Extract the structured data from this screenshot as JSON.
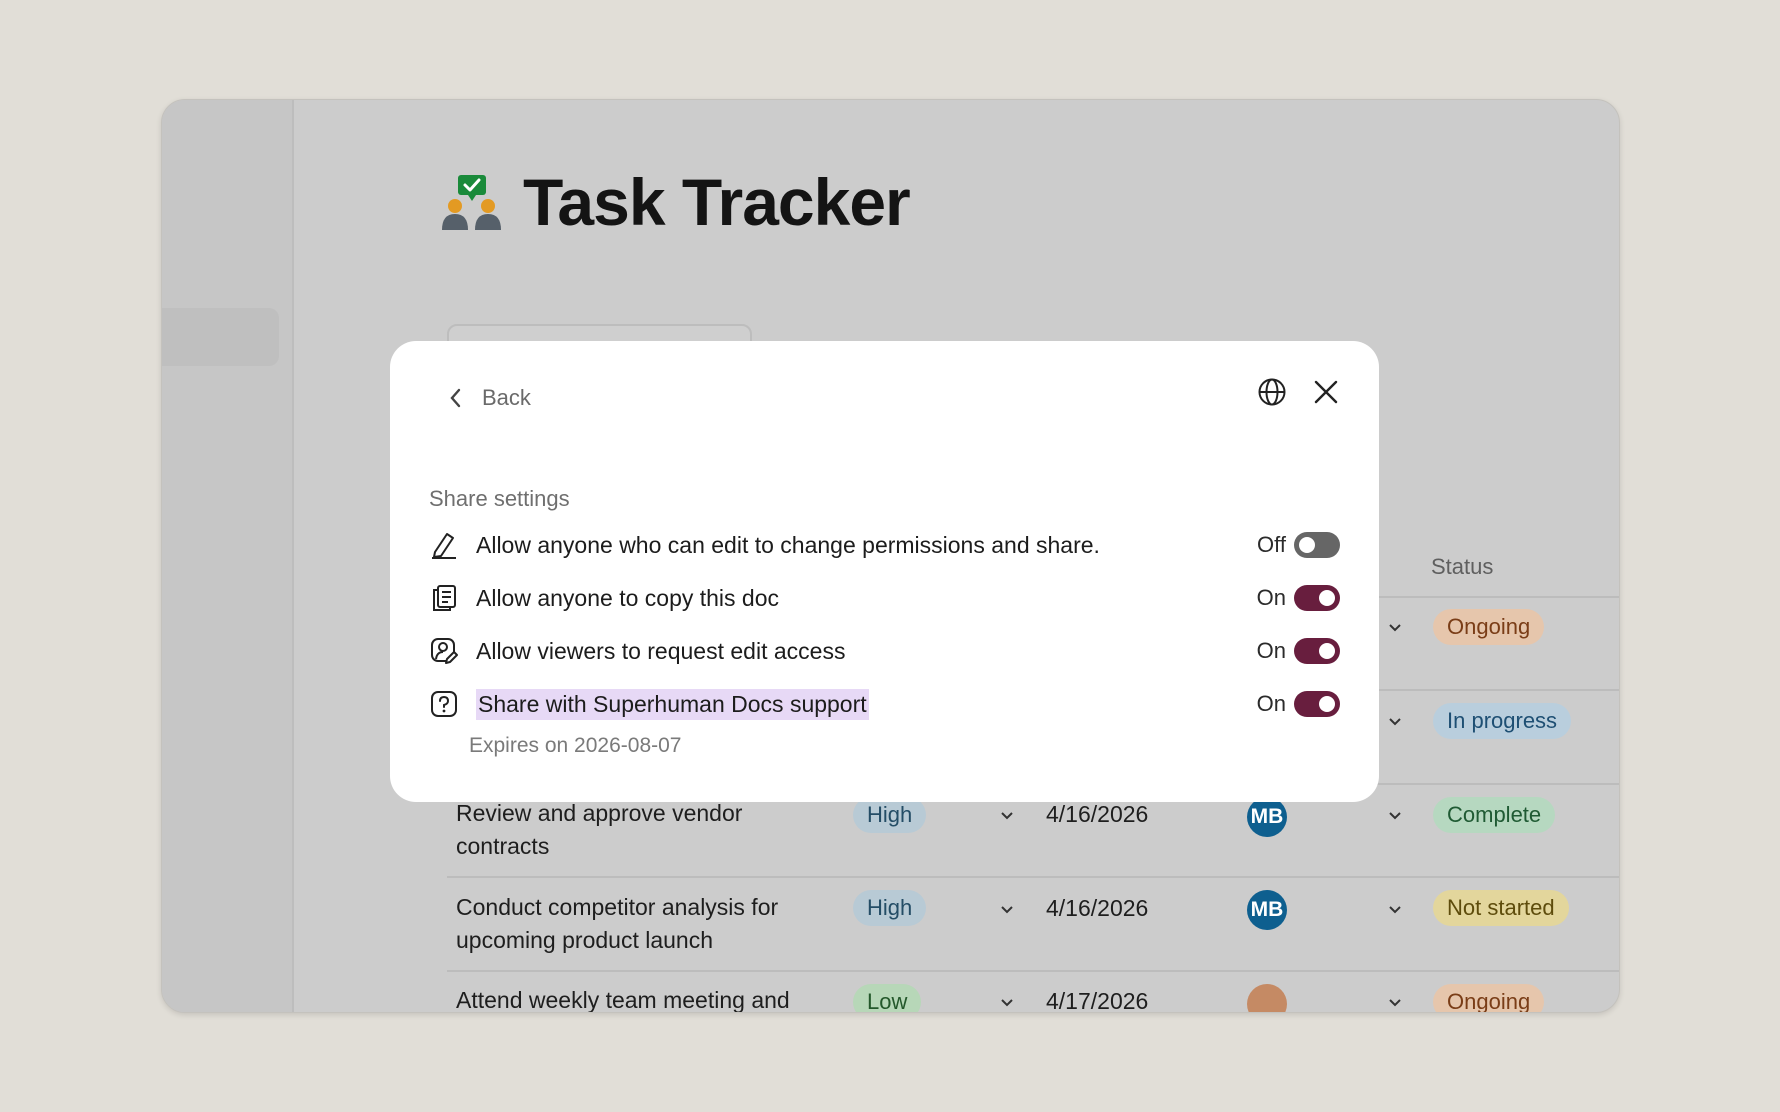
{
  "document": {
    "title": "Task Tracker"
  },
  "table": {
    "status_header": "Status",
    "rows": [
      {
        "status": "Ongoing"
      },
      {
        "status": "In progress"
      },
      {
        "task": "Review and approve vendor contracts",
        "task_line1": "Review and approve vendor",
        "task_line2": "contracts",
        "priority": "High",
        "due": "4/16/2026",
        "owner": "MB",
        "status": "Complete"
      },
      {
        "task": "Conduct competitor analysis for upcoming product launch",
        "task_line1": "Conduct competitor analysis for",
        "task_line2": "upcoming product launch",
        "priority": "High",
        "due": "4/16/2026",
        "owner": "MB",
        "status": "Not started"
      },
      {
        "task_line1": "Attend weekly team meeting and",
        "priority": "Low",
        "due": "4/17/2026",
        "status": "Ongoing"
      }
    ]
  },
  "modal": {
    "back_label": "Back",
    "section_title": "Share settings",
    "settings": [
      {
        "label": "Allow anyone who can edit to change permissions and share.",
        "state": "Off",
        "icon": "pen-icon"
      },
      {
        "label": "Allow anyone to copy this doc",
        "state": "On",
        "icon": "copy-doc-icon"
      },
      {
        "label": "Allow viewers to request edit access",
        "state": "On",
        "icon": "user-edit-icon"
      },
      {
        "label": "Share with Superhuman Docs support",
        "state": "On",
        "icon": "help-icon"
      }
    ],
    "expires": "Expires on 2026-08-07"
  },
  "colors": {
    "toggle_on": "#681e3e",
    "toggle_off": "#666666",
    "highlight": "#e7d9f6",
    "chip_ongoing": "#e6c6ac",
    "chip_in_progress": "#b9cedd",
    "chip_complete": "#b6d8c0",
    "chip_not_started": "#e3d69c",
    "chip_high": "#b8cad5",
    "chip_low": "#b7d7b8",
    "avatar_blue": "#0e5f8f"
  }
}
